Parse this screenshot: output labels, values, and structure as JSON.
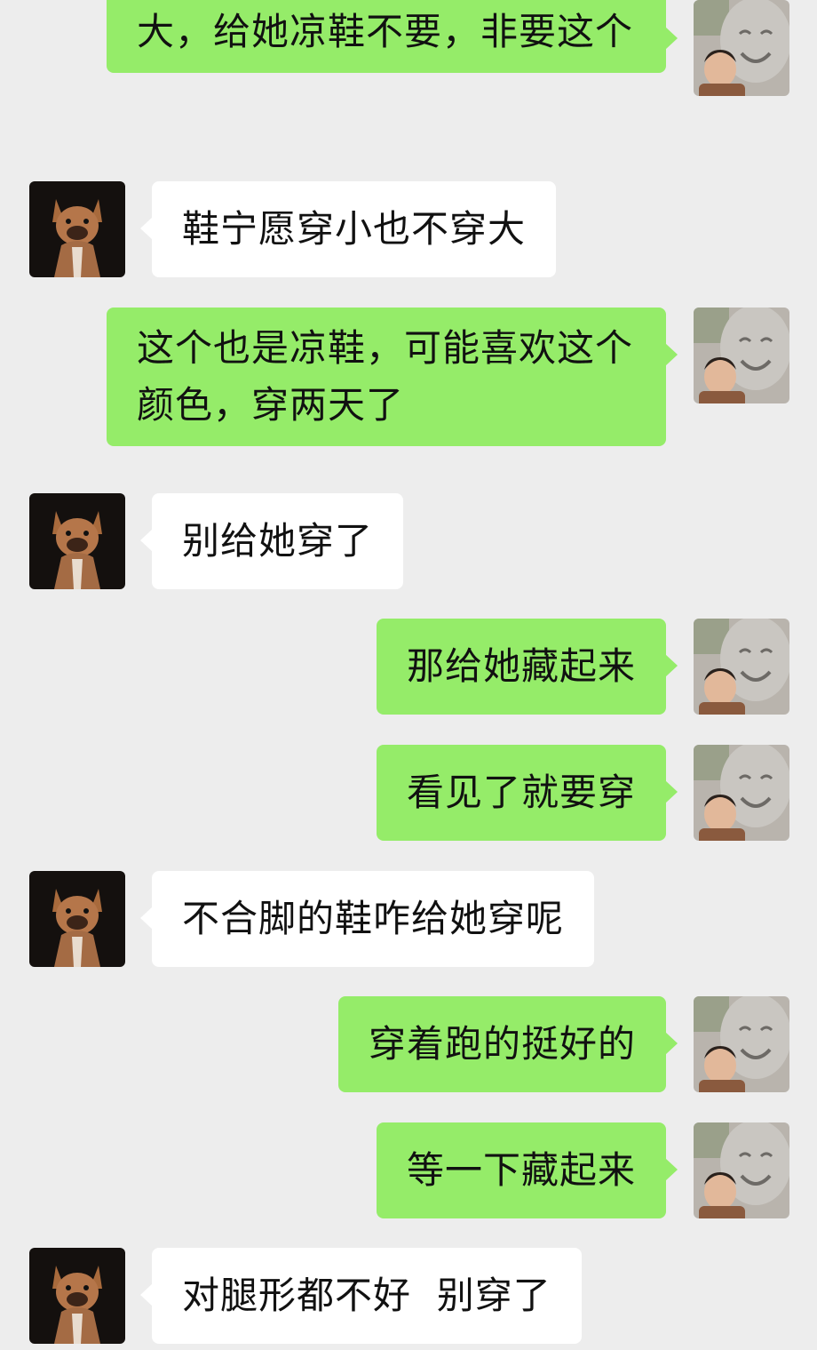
{
  "messages": [
    {
      "side": "out",
      "text": "大，给她凉鞋不要，非要这个"
    },
    {
      "side": "in",
      "text": "鞋宁愿穿小也不穿大"
    },
    {
      "side": "out",
      "text": "这个也是凉鞋，可能喜欢这个颜色，穿两天了"
    },
    {
      "side": "in",
      "text": "别给她穿了"
    },
    {
      "side": "out",
      "text": "那给她藏起来"
    },
    {
      "side": "out",
      "text": "看见了就要穿"
    },
    {
      "side": "in",
      "text": "不合脚的鞋咋给她穿呢"
    },
    {
      "side": "out",
      "text": "穿着跑的挺好的"
    },
    {
      "side": "out",
      "text": "等一下藏起来"
    },
    {
      "side": "in",
      "text": "对腿形都不好  别穿了"
    }
  ],
  "colors": {
    "background": "#ededed",
    "outgoing_bubble": "#95ec69",
    "incoming_bubble": "#ffffff"
  },
  "icons": {
    "incoming_avatar": "french-bulldog-avatar-icon",
    "outgoing_avatar": "buddha-statue-selfie-avatar-icon"
  }
}
